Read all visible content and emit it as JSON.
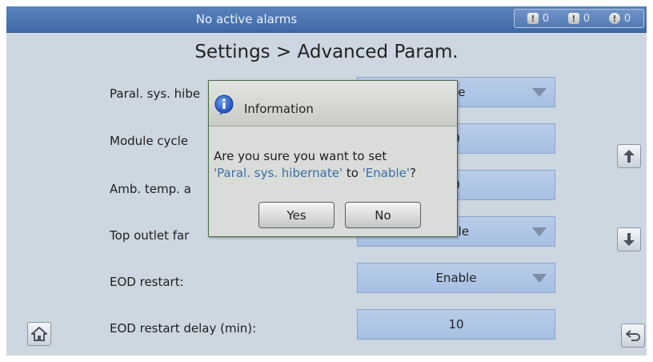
{
  "header": {
    "alarm_status": "No active alarms",
    "counts": {
      "major": "0",
      "minor": "0",
      "warning": "0"
    },
    "icons": [
      "major-alarm-icon",
      "minor-alarm-icon",
      "warning-alarm-icon"
    ]
  },
  "page_title": "Settings > Advanced Param.",
  "rows": [
    {
      "label": "Paral. sys. hibe",
      "value": "ble",
      "type": "dropdown"
    },
    {
      "label": "Module cycle",
      "value": "0",
      "type": "input"
    },
    {
      "label": "Amb. temp. a",
      "value": "0",
      "type": "input"
    },
    {
      "label": "Top outlet far",
      "value": "able",
      "type": "dropdown"
    },
    {
      "label": "EOD restart:",
      "value": "Enable",
      "type": "dropdown"
    },
    {
      "label": "EOD restart delay (min):",
      "value": "10",
      "type": "input"
    }
  ],
  "nav": {
    "up_icon": "arrow-up-icon",
    "down_icon": "arrow-down-icon",
    "home_icon": "home-icon",
    "back_icon": "back-arrow-icon"
  },
  "dialog": {
    "title": "Information",
    "icon": "info-icon",
    "message_line1": "Are you sure you want to set",
    "param_quoted": "'Paral. sys. hibernate'",
    "to_word": " to ",
    "value_quoted": "'Enable'",
    "question_mark": "?",
    "yes_label": "Yes",
    "no_label": "No"
  },
  "colors": {
    "header_bg": "#4a73b0",
    "screen_bg": "#cdd7e2",
    "field_bg": "#b0c6e6",
    "quote_text": "#3a6fa8"
  }
}
